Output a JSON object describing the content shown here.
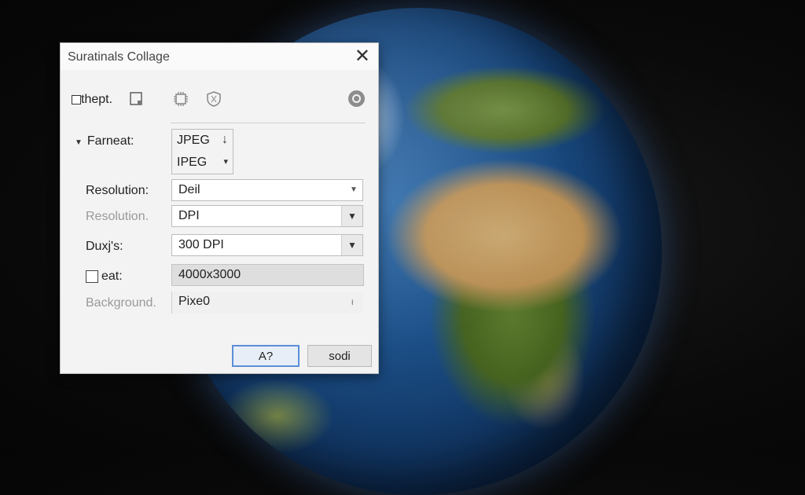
{
  "dialog": {
    "title": "Suratinals  Collage",
    "close_glyph": "✕"
  },
  "toolbar": {
    "checkbox_label": "thept."
  },
  "form": {
    "format_label": "Farneat:",
    "format_options": [
      "JPEG",
      "IPEG"
    ],
    "resolution_label": "Resolution:",
    "resolution_value": "Deil",
    "resolution2_label": "Resolution.",
    "resolution2_value": "DPI",
    "dpi_label": "Duxj's:",
    "dpi_value": "300 DPI",
    "size_checkbox_label": "eat:",
    "size_value": "4000x3000",
    "background_label": "Background.",
    "background_value": "Pixe0"
  },
  "buttons": {
    "primary_label": "A?",
    "secondary_label": "sodi"
  }
}
